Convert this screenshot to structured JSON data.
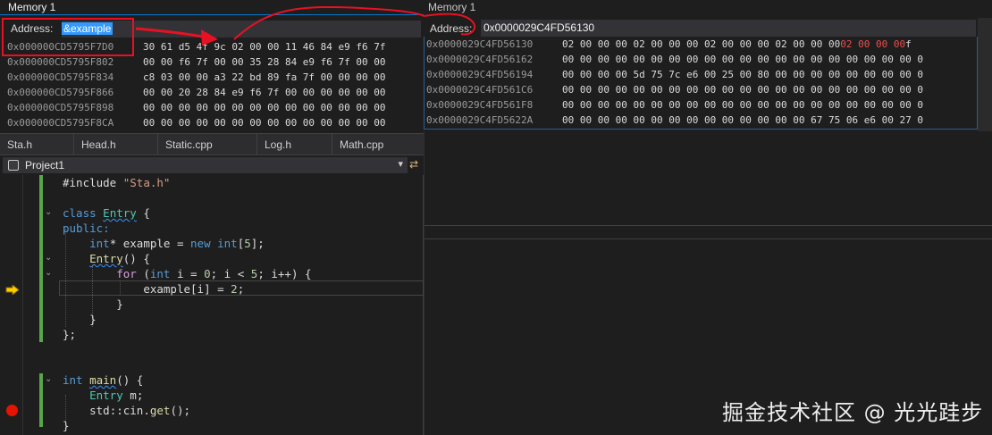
{
  "mem1": {
    "title": "Memory 1",
    "address_label": "Address:",
    "address_value": "&example",
    "rows": [
      {
        "addr": "0x000000CD5795F7D0",
        "bytes": "30 61 d5 4f 9c 02 00 00 11 46 84 e9 f6 7f"
      },
      {
        "addr": "0x000000CD5795F802",
        "bytes": "00 00 f6 7f 00 00 35 28 84 e9 f6 7f 00 00"
      },
      {
        "addr": "0x000000CD5795F834",
        "bytes": "c8 03 00 00 a3 22 bd 89 fa 7f 00 00 00 00"
      },
      {
        "addr": "0x000000CD5795F866",
        "bytes": "00 00 20 28 84 e9 f6 7f 00 00 00 00 00 00"
      },
      {
        "addr": "0x000000CD5795F898",
        "bytes": "00 00 00 00 00 00 00 00 00 00 00 00 00 00"
      },
      {
        "addr": "0x000000CD5795F8CA",
        "bytes": "00 00 00 00 00 00 00 00 00 00 00 00 00 00"
      }
    ]
  },
  "mem2": {
    "title": "Memory 1",
    "address_label": "Address:",
    "address_value": "0x0000029C4FD56130",
    "rows": [
      {
        "addr": "0x0000029C4FD56130",
        "bytes": "02 00 00 00 02 00 00 00 02 00 00 00 02 00 00 00 ",
        "red": "02 00 00 00",
        "tail": " f"
      },
      {
        "addr": "0x0000029C4FD56162",
        "bytes": "00 00 00 00 00 00 00 00 00 00 00 00 00 00 00 00 00 00 00 00 0"
      },
      {
        "addr": "0x0000029C4FD56194",
        "bytes": "00 00 00 00 5d 75 7c e6 00 25 00 80 00 00 00 00 00 00 00 00 0"
      },
      {
        "addr": "0x0000029C4FD561C6",
        "bytes": "00 00 00 00 00 00 00 00 00 00 00 00 00 00 00 00 00 00 00 00 0"
      },
      {
        "addr": "0x0000029C4FD561F8",
        "bytes": "00 00 00 00 00 00 00 00 00 00 00 00 00 00 00 00 00 00 00 00 0"
      },
      {
        "addr": "0x0000029C4FD5622A",
        "bytes": "00 00 00 00 00 00 00 00 00 00 00 00 00 00 67 75 06 e6 00 27 0"
      }
    ]
  },
  "tabs": [
    "Sta.h",
    "Head.h",
    "Static.cpp",
    "Log.h",
    "Math.cpp"
  ],
  "project": {
    "name": "Project1",
    "dropdown": "▾"
  },
  "code": {
    "include_kw": "#include",
    "include_str": "\"Sta.h\"",
    "class_kw": "class",
    "entry": "Entry",
    "brace_open": " {",
    "public": "public:",
    "int": "int",
    "star": "*",
    "example_decl": " example = ",
    "new": "new",
    "arr": "[",
    "five": "5",
    "arr_end": "];",
    "ctor_rest": "() {",
    "for": "for",
    "for_open": " (",
    "i": "i",
    "eq0": " = ",
    "zero": "0",
    "semi": "; ",
    "lt": " < ",
    "inc": "++) {",
    "assign": "example[",
    "assign_end": "] = ",
    "two": "2",
    "semi_end": ";",
    "close": "}",
    "class_close": "};",
    "main": "main",
    "main_rest": "() {",
    "m": "m",
    "std": "std",
    "scope": "::",
    "cin": "cin",
    "dot": ".",
    "get": "get",
    "get_end": "();"
  },
  "watermark": "掘金技术社区 @ 光光跬步",
  "colors": {
    "annotation": "#e81123",
    "accent": "#007acc",
    "breakpoint": "#e51400",
    "change_bar": "#57a64a"
  }
}
